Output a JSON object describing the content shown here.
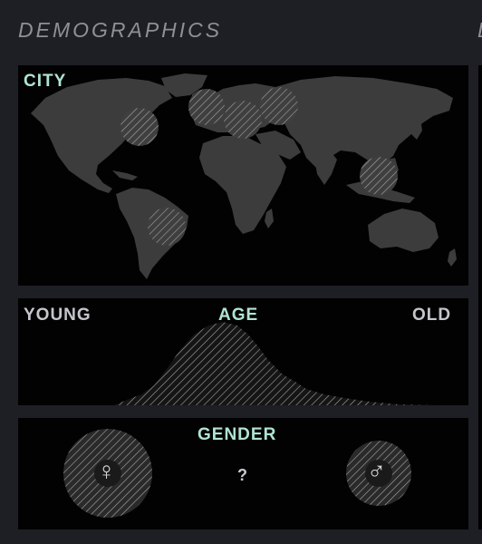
{
  "header": {
    "title": "DEMOGRAPHICS",
    "next_title": "D"
  },
  "city": {
    "label": "CITY",
    "markers": [
      {
        "name": "north-america"
      },
      {
        "name": "western-europe"
      },
      {
        "name": "central-europe"
      },
      {
        "name": "eastern-europe"
      },
      {
        "name": "southeast-asia"
      },
      {
        "name": "south-america"
      }
    ]
  },
  "age": {
    "label": "AGE",
    "left_label": "YOUNG",
    "right_label": "OLD"
  },
  "gender": {
    "label": "GENDER",
    "female_symbol": "♀",
    "unknown_symbol": "?",
    "male_symbol": "♂"
  },
  "colors": {
    "background": "#1d1f24",
    "panel": "#020202",
    "accent": "#b0e4d2",
    "label": "#c3c6cb",
    "map_land": "#3c3c3c",
    "hatch": "#a5a5a5"
  },
  "icons": [
    "globe-map",
    "hatched-circle",
    "female-icon",
    "question-icon",
    "male-icon"
  ]
}
